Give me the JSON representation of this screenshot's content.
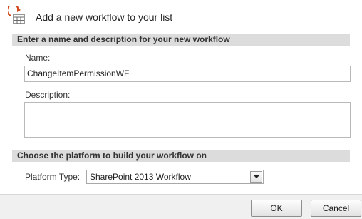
{
  "dialog": {
    "title": "Add a new workflow to your list",
    "icon": "workflow-add-icon"
  },
  "section_name": {
    "header": "Enter a name and description for your new workflow",
    "name_label": "Name:",
    "name_value": "ChangeItemPermissionWF",
    "description_label": "Description:",
    "description_value": ""
  },
  "section_platform": {
    "header": "Choose the platform to build your workflow on",
    "platform_label": "Platform Type:",
    "platform_value": "SharePoint 2013 Workflow"
  },
  "buttons": {
    "ok": "OK",
    "cancel": "Cancel"
  }
}
